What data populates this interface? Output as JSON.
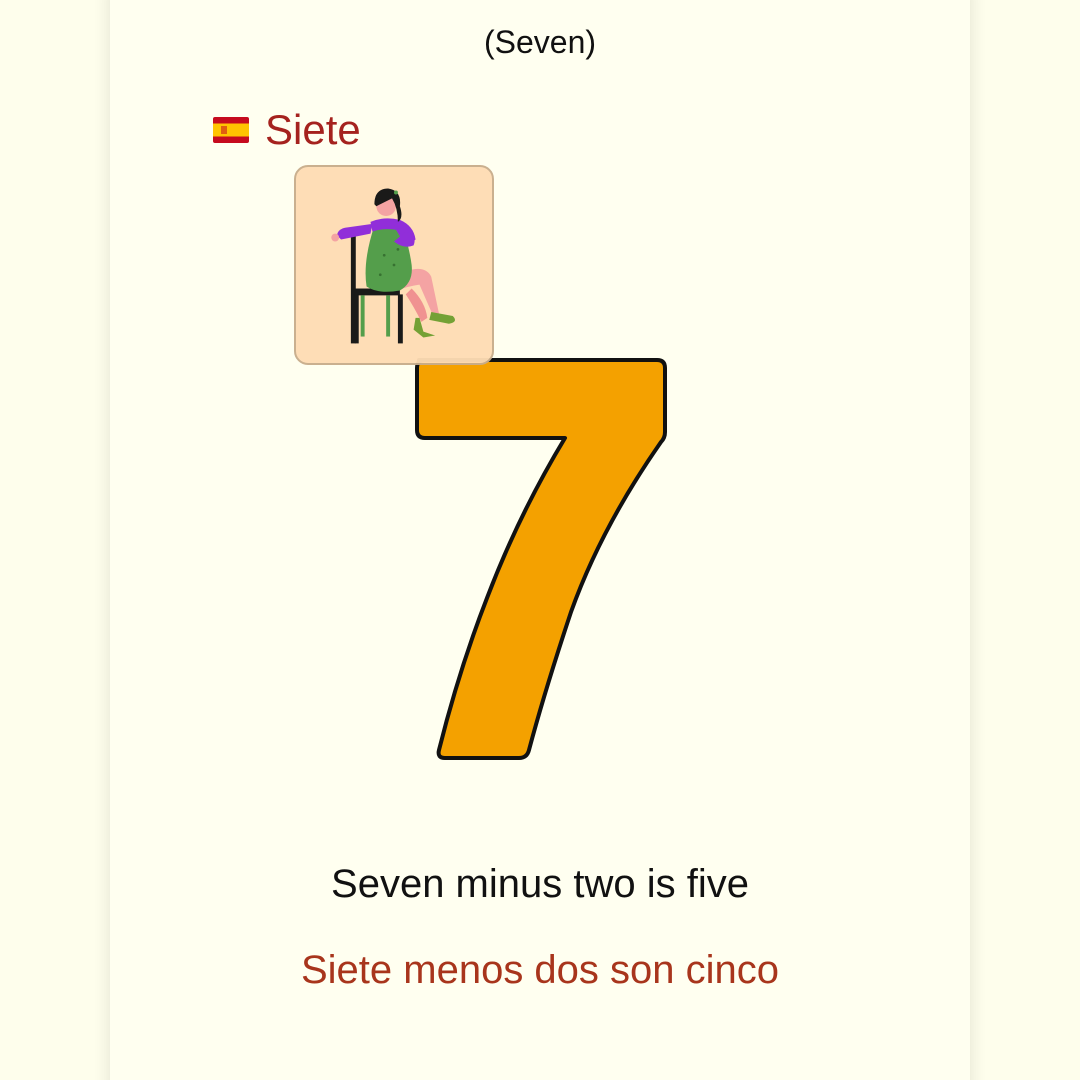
{
  "header": {
    "english_word": "(Seven)"
  },
  "spanish": {
    "flag_icon": "spain-flag-icon",
    "word": "Siete"
  },
  "illustration": {
    "icon": "girl-sitting-on-chair-illustration"
  },
  "numeral": {
    "value": "7",
    "fill_color": "#f4a100",
    "stroke_color": "#111111"
  },
  "sentences": {
    "english": "Seven minus two is five",
    "spanish": "Siete menos dos son cinco"
  },
  "colors": {
    "background": "#fefeec",
    "card": "#fffff0",
    "spanish_text": "#a5221e",
    "picture_card": "#fedcb4"
  }
}
